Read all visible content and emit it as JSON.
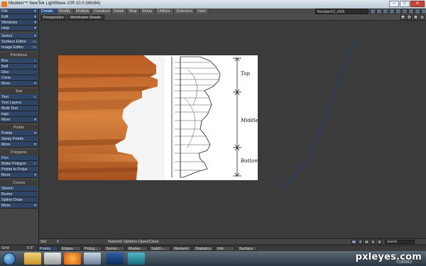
{
  "window": {
    "title": "Modeler™ NewTek LightWave 10® 10.0 (Win64)"
  },
  "top_tabs": [
    "Create",
    "Modify",
    "Multiply",
    "Construct",
    "Detail",
    "Map",
    "Setup",
    "Utilities",
    "Selection",
    "View"
  ],
  "file_select": "floorplan10_s036",
  "viewport": {
    "projection": "Perspective",
    "shading": "Wireframe Shade"
  },
  "sidebar": {
    "menus": [
      {
        "label": "File",
        "mode": "arrow"
      },
      {
        "label": "Edit",
        "mode": "arrow"
      },
      {
        "label": "Windows",
        "mode": "arrow"
      },
      {
        "label": "Help",
        "mode": "arrow"
      }
    ],
    "tools_top": [
      {
        "label": "Select",
        "mode": "arrow"
      },
      {
        "label": "Surface Editor",
        "key": "F5"
      },
      {
        "label": "Image Editor",
        "key": "F6"
      }
    ],
    "primitives_title": "Primitives",
    "primitives": [
      {
        "label": "Box",
        "key": "X"
      },
      {
        "label": "Ball",
        "key": "O"
      },
      {
        "label": "Disc"
      },
      {
        "label": "Cone"
      },
      {
        "label": "More",
        "mode": "arrow"
      }
    ],
    "text_title": "Text",
    "text": [
      {
        "label": "Text",
        "key": "W"
      },
      {
        "label": "Text Layers"
      },
      {
        "label": "Multi Text"
      },
      {
        "label": "logo"
      },
      {
        "label": "More",
        "mode": "arrow"
      }
    ],
    "points_title": "Points",
    "points": [
      {
        "label": "Points",
        "mode": "arrow"
      },
      {
        "label": "Spray Points"
      },
      {
        "label": "More",
        "mode": "arrow"
      }
    ],
    "polygons_title": "Polygons",
    "polygons": [
      {
        "label": "Pen"
      },
      {
        "label": "Make Polygon",
        "key": "P"
      },
      {
        "label": "Points to Polys"
      },
      {
        "label": "More",
        "mode": "arrow"
      }
    ],
    "curves_title": "Curves",
    "curves": [
      {
        "label": "Sketch"
      },
      {
        "label": "Bezier"
      },
      {
        "label": "Spline Draw"
      },
      {
        "label": "More",
        "mode": "arrow"
      }
    ]
  },
  "reference_image": {
    "labels": {
      "top": "Top",
      "middle": "Middle",
      "bottom": "Bottom"
    }
  },
  "status": {
    "set_label": "Sel",
    "set_value": "0",
    "message": "Numeric Options Open/Close",
    "modes": [
      "W",
      "T",
      "M",
      "C",
      "S"
    ],
    "vmap": "(none)"
  },
  "bottom": {
    "grid_label": "Grid:",
    "grid_value": "0.5\"",
    "buttons": [
      "Points",
      "Edges",
      "Polyg...",
      "Symm...",
      "Modes",
      "SubD-...",
      "Numeric",
      "Statistics",
      "Info",
      "Surface"
    ]
  },
  "taskbar": {
    "watermark": "pxleyes.com",
    "date": "7/13/2012"
  },
  "colors": {
    "active_tab": "#2e4a78",
    "sidebar_btn": "#2f4566",
    "wood": "#c8733a"
  }
}
